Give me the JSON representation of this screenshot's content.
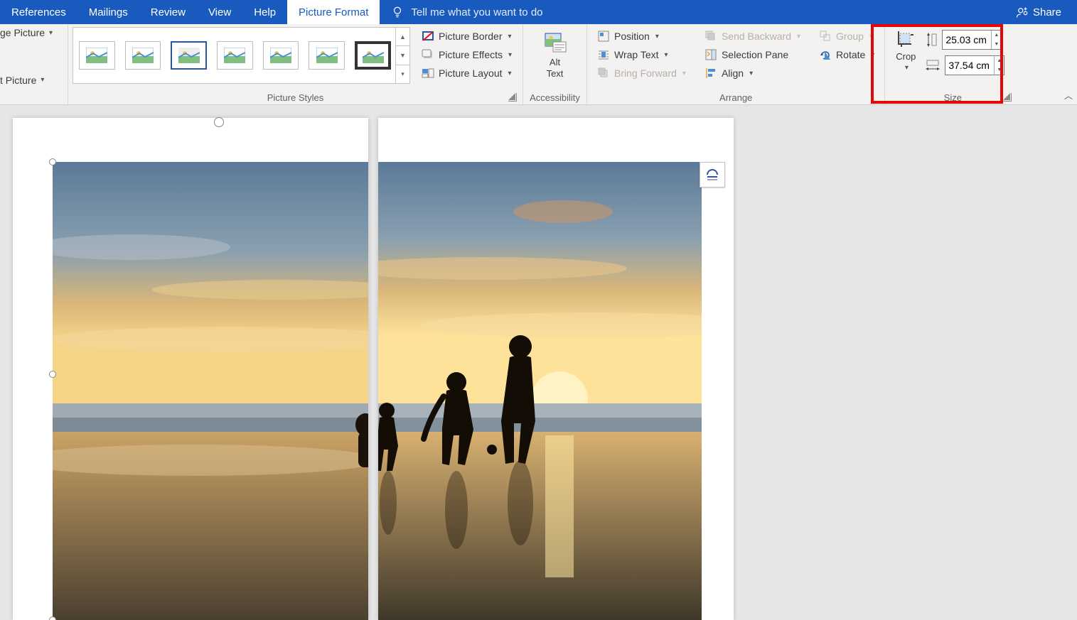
{
  "tabs": {
    "references": "References",
    "mailings": "Mailings",
    "review": "Review",
    "view": "View",
    "help": "Help",
    "picture_format": "Picture Format",
    "tellme": "Tell me what you want to do",
    "share": "Share"
  },
  "partial": {
    "change_picture": "ge Picture",
    "reset_picture": "t Picture"
  },
  "groups": {
    "picture_styles": "Picture Styles",
    "accessibility": "Accessibility",
    "arrange": "Arrange",
    "size": "Size"
  },
  "buttons": {
    "picture_border": "Picture Border",
    "picture_effects": "Picture Effects",
    "picture_layout": "Picture Layout",
    "alt_text_1": "Alt",
    "alt_text_2": "Text",
    "position": "Position",
    "wrap_text": "Wrap Text",
    "bring_forward": "Bring Forward",
    "send_backward": "Send Backward",
    "selection_pane": "Selection Pane",
    "align": "Align",
    "group": "Group",
    "rotate": "Rotate",
    "crop": "Crop"
  },
  "size": {
    "height": "25.03 cm",
    "width": "37.54 cm"
  }
}
